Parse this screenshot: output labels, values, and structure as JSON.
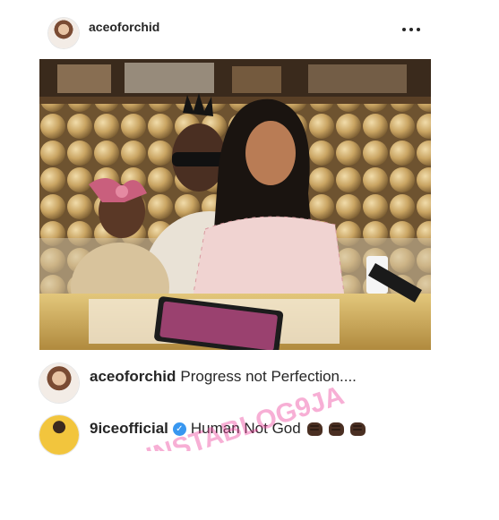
{
  "post": {
    "username": "aceoforchid",
    "more_icon": "more-horizontal-icon"
  },
  "comments": [
    {
      "user": "aceoforchid",
      "text": "Progress not Perfection....",
      "verified": false
    },
    {
      "user": "9iceofficial",
      "text": "Human Not God",
      "verified": true,
      "emoji_count": 3
    }
  ],
  "watermark": {
    "text": "INSTABLOG9JA"
  },
  "colors": {
    "text": "#262626",
    "verified": "#3897f0",
    "watermark": "#ec409a"
  }
}
